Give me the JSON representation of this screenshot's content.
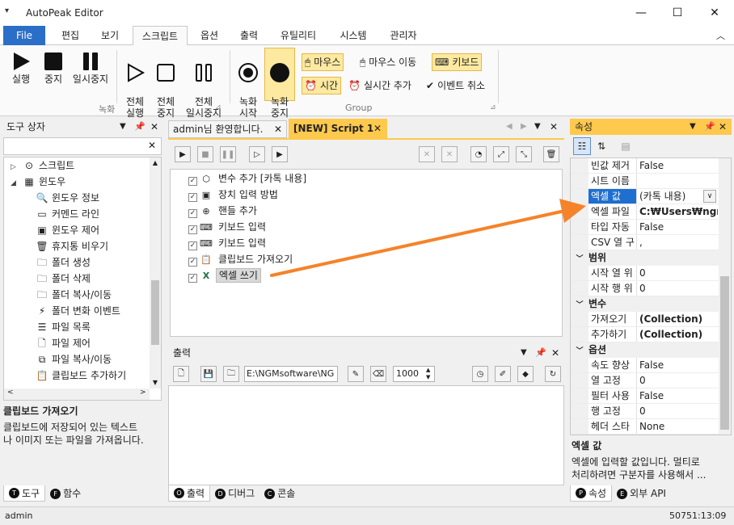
{
  "app": {
    "title": "AutoPeak Editor"
  },
  "menu": {
    "tabs": [
      "File",
      "편집",
      "보기",
      "스크립트",
      "옵션",
      "출력",
      "유틸리티",
      "시스템",
      "관리자"
    ]
  },
  "ribbon": {
    "run": "실행",
    "stop": "중지",
    "pause": "일시중지",
    "run_all": "전체\n실행",
    "stop_all": "전체\n중지",
    "pause_all": "전체\n일시중지",
    "rec_start": "녹화\n시작",
    "rec_stop": "녹화\n중지",
    "mouse": "마우스",
    "mouse_move": "마우스 이동",
    "keyboard": "키보드",
    "time": "시간",
    "realtime_add": "실시간 추가",
    "event_cancel": "이벤트 취소",
    "group_record": "녹화",
    "group_group": "Group"
  },
  "toolbox": {
    "title": "도구 상자",
    "items": [
      {
        "label": "스크립트",
        "level": 0,
        "expand": "▷",
        "icon": "script-icon",
        "glyph": "⊙"
      },
      {
        "label": "윈도우",
        "level": 0,
        "expand": "◢",
        "icon": "windows-icon",
        "glyph": "▦"
      },
      {
        "label": "윈도우 정보",
        "level": 1,
        "icon": "magnifier-icon",
        "glyph": "🔍"
      },
      {
        "label": "커멘드 라인",
        "level": 1,
        "icon": "cmd-icon",
        "glyph": "▭"
      },
      {
        "label": "윈도우 제어",
        "level": 1,
        "icon": "window-control-icon",
        "glyph": "▣"
      },
      {
        "label": "휴지통 비우기",
        "level": 1,
        "icon": "trash-icon",
        "glyph": "🗑"
      },
      {
        "label": "폴더 생성",
        "level": 1,
        "icon": "folder-add-icon",
        "glyph": "🗀"
      },
      {
        "label": "폴더 삭제",
        "level": 1,
        "icon": "folder-delete-icon",
        "glyph": "🗀"
      },
      {
        "label": "폴더 복사/이동",
        "level": 1,
        "icon": "folder-copy-icon",
        "glyph": "🗀"
      },
      {
        "label": "폴더 변화 이벤트",
        "level": 1,
        "icon": "lightning-icon",
        "glyph": "⚡"
      },
      {
        "label": "파일 목록",
        "level": 1,
        "icon": "file-list-icon",
        "glyph": "☰"
      },
      {
        "label": "파일 제어",
        "level": 1,
        "icon": "file-control-icon",
        "glyph": "🗋"
      },
      {
        "label": "파일 복사/이동",
        "level": 1,
        "icon": "file-copy-icon",
        "glyph": "⧉"
      },
      {
        "label": "클립보드 추가하기",
        "level": 1,
        "icon": "clipboard-add-icon",
        "glyph": "📋"
      }
    ],
    "desc_title": "클립보드 가져오기",
    "desc_text": "클립보드에 저장되어 있는 텍스트\n나 이미지 또는 파일을 가져옵니다.",
    "tabs": [
      {
        "letter": "T",
        "label": "도구"
      },
      {
        "letter": "F",
        "label": "함수"
      }
    ]
  },
  "editor": {
    "tabs": [
      "admin님 환영합니다.",
      "[NEW] Script 1"
    ],
    "lines": [
      {
        "label": "변수 추가 [카톡 내용]",
        "icon": "variable-icon",
        "glyph": "⬡"
      },
      {
        "label": "장치 입력 방법",
        "icon": "device-input-icon",
        "glyph": "▣"
      },
      {
        "label": "핸들 추가",
        "icon": "crosshair-icon",
        "glyph": "⊕"
      },
      {
        "label": "키보드 입력",
        "icon": "keyboard-icon",
        "glyph": "⌨"
      },
      {
        "label": "키보드 입력",
        "icon": "keyboard-icon",
        "glyph": "⌨"
      },
      {
        "label": "클립보드 가져오기",
        "icon": "clipboard-icon",
        "glyph": "📋"
      },
      {
        "label": "엑셀 쓰기",
        "icon": "excel-icon",
        "glyph": "X"
      }
    ]
  },
  "output": {
    "title": "출력",
    "path": "E:\\NGMsoftware\\NG",
    "count": "1000",
    "tabs": [
      {
        "letter": "O",
        "label": "출력"
      },
      {
        "letter": "D",
        "label": "디버그"
      },
      {
        "letter": "C",
        "label": "콘솔"
      }
    ]
  },
  "properties": {
    "title": "속성",
    "rows": [
      {
        "type": "prop",
        "name": "빈값 제거",
        "value": "False"
      },
      {
        "type": "prop",
        "name": "시트 이름",
        "value": ""
      },
      {
        "type": "prop",
        "name": "엑셀 값",
        "value": "(카톡 내용)",
        "selected": true
      },
      {
        "type": "prop",
        "name": "엑셀 파일",
        "value": "C:₩Users₩ngma",
        "bold": true
      },
      {
        "type": "prop",
        "name": "타입 자동",
        "value": "False"
      },
      {
        "type": "prop",
        "name": "CSV 열 구",
        "value": ","
      },
      {
        "type": "cat",
        "name": "범위"
      },
      {
        "type": "prop",
        "name": "시작 열 위",
        "value": "0"
      },
      {
        "type": "prop",
        "name": "시작 행 위",
        "value": "0"
      },
      {
        "type": "cat",
        "name": "변수"
      },
      {
        "type": "prop",
        "name": "가져오기",
        "value": "(Collection)",
        "bold": true
      },
      {
        "type": "prop",
        "name": "추가하기",
        "value": "(Collection)",
        "bold": true
      },
      {
        "type": "cat",
        "name": "옵션"
      },
      {
        "type": "prop",
        "name": "속도 향상",
        "value": "False"
      },
      {
        "type": "prop",
        "name": "열 고정",
        "value": "0"
      },
      {
        "type": "prop",
        "name": "필터 사용",
        "value": "False"
      },
      {
        "type": "prop",
        "name": "행 고정",
        "value": "0"
      },
      {
        "type": "prop",
        "name": "헤더 스타",
        "value": "None"
      }
    ],
    "desc_title": "엑셀 값",
    "desc_text": "엑셀에 입력할 값입니다. 멀티로\n처리하려면 구분자를 사용해서 ...",
    "tabs": [
      {
        "letter": "P",
        "label": "속성"
      },
      {
        "letter": "E",
        "label": "외부 API"
      }
    ]
  },
  "status": {
    "user": "admin",
    "clock": "50751:13:09"
  },
  "colors": {
    "accent": "#2a6ec8",
    "active_panel": "#ffc94d",
    "arrow": "#f5832a",
    "highlight": "#fde9a0"
  }
}
